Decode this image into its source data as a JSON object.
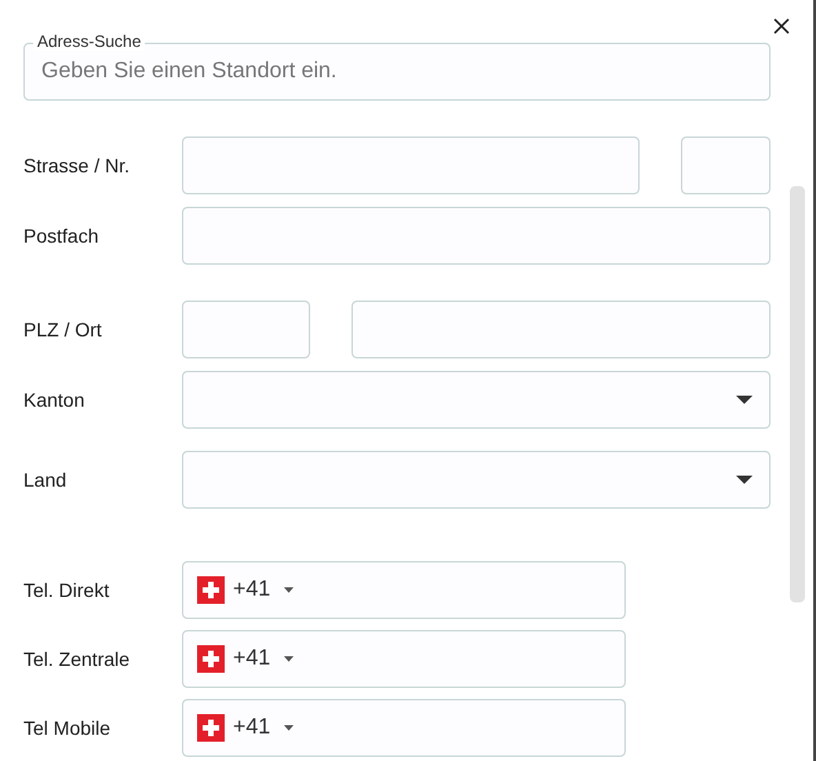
{
  "search": {
    "label": "Adress-Suche",
    "placeholder": "Geben Sie einen Standort ein."
  },
  "rows": [
    {
      "label": "Strasse / Nr.",
      "kind": "split-right"
    },
    {
      "label": "Postfach",
      "kind": "text"
    },
    {
      "label": "PLZ / Ort",
      "kind": "split-left"
    },
    {
      "label": "Kanton",
      "kind": "select"
    },
    {
      "label": "Land",
      "kind": "select"
    },
    {
      "label": "Tel. Direkt",
      "kind": "phone",
      "code": "+41"
    },
    {
      "label": "Tel. Zentrale",
      "kind": "phone",
      "code": "+41"
    },
    {
      "label": "Tel Mobile",
      "kind": "phone",
      "code": "+41"
    }
  ]
}
